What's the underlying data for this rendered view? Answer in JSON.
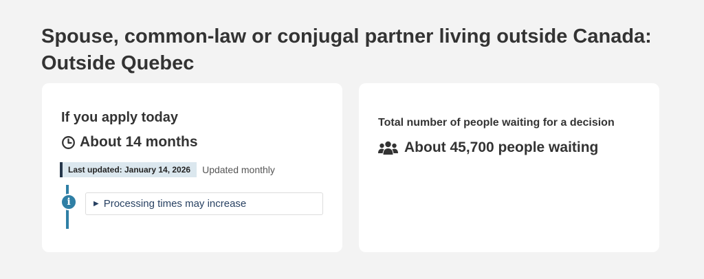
{
  "page": {
    "title": "Spouse, common-law or conjugal partner living outside Canada: Outside Quebec"
  },
  "processing_card": {
    "heading": "If you apply today",
    "time_icon": "clock-icon",
    "time_value": "About 14 months",
    "last_updated": "Last updated: January 14, 2026",
    "update_frequency": "Updated monthly",
    "info_icon": "info-icon",
    "details_summary": "Processing times may increase"
  },
  "waiting_card": {
    "heading": "Total number of people waiting for a decision",
    "people_icon": "users-icon",
    "people_value": "About 45,700 people waiting"
  },
  "colors": {
    "background": "#f3f3f3",
    "card": "#ffffff",
    "text": "#333333",
    "link": "#284162",
    "accent_blue": "#2f7fa5",
    "badge_bg": "#dbe7ee",
    "badge_border": "#26374a"
  }
}
